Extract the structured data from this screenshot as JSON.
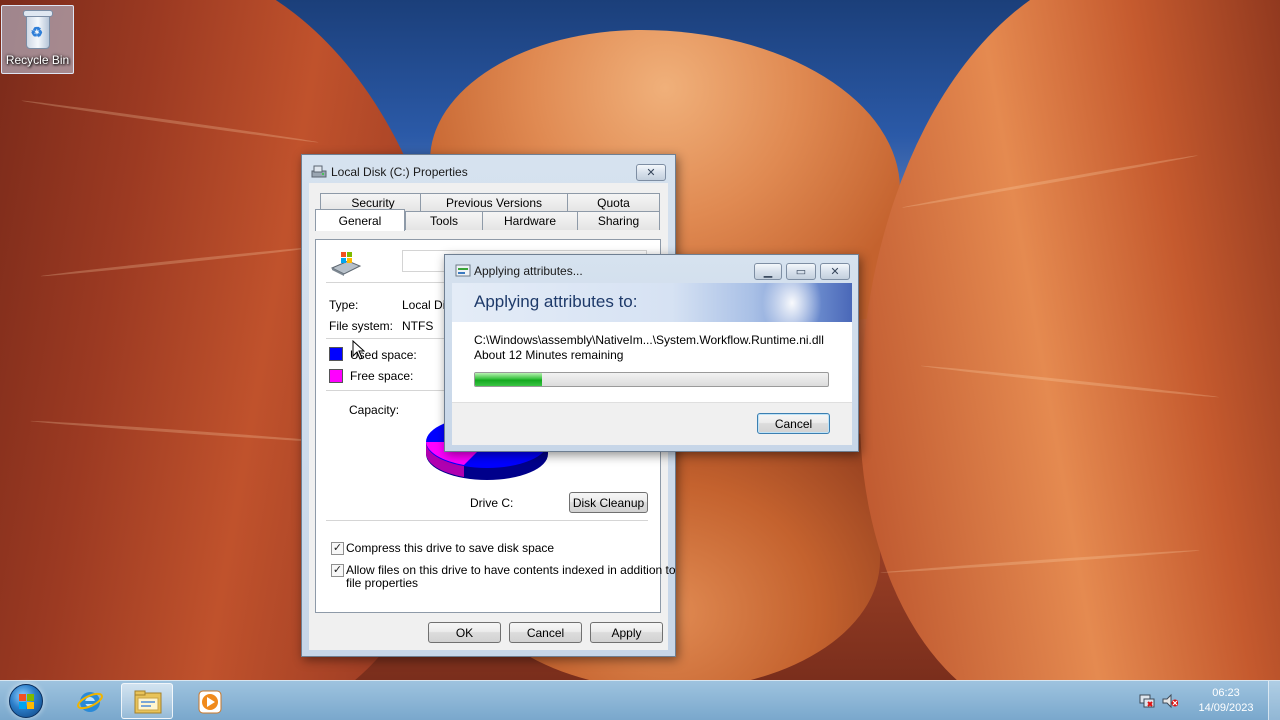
{
  "desktop": {
    "recycle_bin_label": "Recycle Bin"
  },
  "properties_dialog": {
    "title": "Local Disk (C:) Properties",
    "tabs_row1": [
      "Security",
      "Previous Versions",
      "Quota"
    ],
    "tabs_row2": [
      "General",
      "Tools",
      "Hardware",
      "Sharing"
    ],
    "active_tab": "General",
    "type_label": "Type:",
    "type_value": "Local Dis",
    "filesystem_label": "File system:",
    "filesystem_value": "NTFS",
    "used_space_label": "Used space:",
    "free_space_label": "Free space:",
    "capacity_label": "Capacity:",
    "drive_label": "Drive C:",
    "disk_cleanup_label": "Disk Cleanup",
    "compress_label": "Compress this drive to save disk space",
    "compress_checked": true,
    "index_label_line1": "Allow files on this drive to have contents indexed in addition to",
    "index_label_line2": "file properties",
    "index_checked": true,
    "ok_label": "OK",
    "cancel_label": "Cancel",
    "apply_label": "Apply",
    "colors": {
      "used": "#0000ff",
      "free": "#ff00ff"
    }
  },
  "apply_dialog": {
    "title": "Applying attributes...",
    "heading": "Applying attributes to:",
    "path": "C:\\Windows\\assembly\\NativeIm...\\System.Workflow.Runtime.ni.dll",
    "time_remaining": "About 12 Minutes remaining",
    "progress_fraction": 0.19,
    "cancel_label": "Cancel"
  },
  "taskbar": {
    "time": "06:23",
    "date": "14/09/2023",
    "pinned": [
      "start-button",
      "internet-explorer",
      "windows-explorer",
      "media-player"
    ],
    "active_item": "windows-explorer"
  }
}
